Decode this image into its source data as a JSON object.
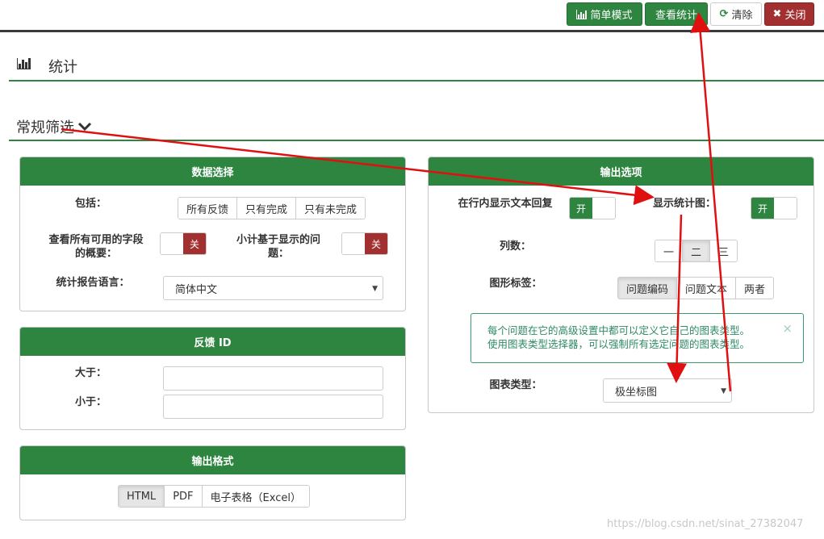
{
  "toolbar": {
    "simple_mode": "简单模式",
    "view_stats": "查看统计",
    "clear": "清除",
    "close": "关闭"
  },
  "header": {
    "title": "统计"
  },
  "filter": {
    "title": "常规筛选"
  },
  "data_selection": {
    "title": "数据选择",
    "include_label": "包括：",
    "include_options": [
      "所有反馈",
      "只有完成",
      "只有未完成"
    ],
    "view_all_label": "查看所有可用的字段的概要：",
    "view_all_toggle": "关",
    "subtotal_label": "小计基于显示的问题：",
    "subtotal_toggle": "关",
    "language_label": "统计报告语言：",
    "language_value": "简体中文"
  },
  "response_id": {
    "title": "反馈 ID",
    "greater_label": "大于：",
    "less_label": "小于："
  },
  "output_format": {
    "title": "输出格式",
    "options": [
      "HTML",
      "PDF",
      "电子表格（Excel）"
    ],
    "selected": "HTML"
  },
  "output_options": {
    "title": "输出选项",
    "inline_text_label": "在行内显示文本回复",
    "inline_text_toggle": "开",
    "show_graph_label": "显示统计图：",
    "show_graph_toggle": "开",
    "columns_label": "列数：",
    "columns_options": [
      "一",
      "二",
      "三"
    ],
    "columns_selected": "二",
    "graph_labels_label": "图形标签：",
    "graph_labels_options": [
      "问题编码",
      "问题文本",
      "两者"
    ],
    "graph_labels_selected": "问题编码",
    "info_line1": "每个问题在它的高级设置中都可以定义它自己的图表类型。",
    "info_line2": "使用图表类型选择器，可以强制所有选定问题的图表类型。",
    "chart_type_label": "图表类型：",
    "chart_type_value": "极坐标图"
  },
  "watermark": "https://blog.csdn.net/sinat_27382047",
  "colors": {
    "green": "#2e8540",
    "red": "#a33030",
    "arrow": "#e01010"
  }
}
